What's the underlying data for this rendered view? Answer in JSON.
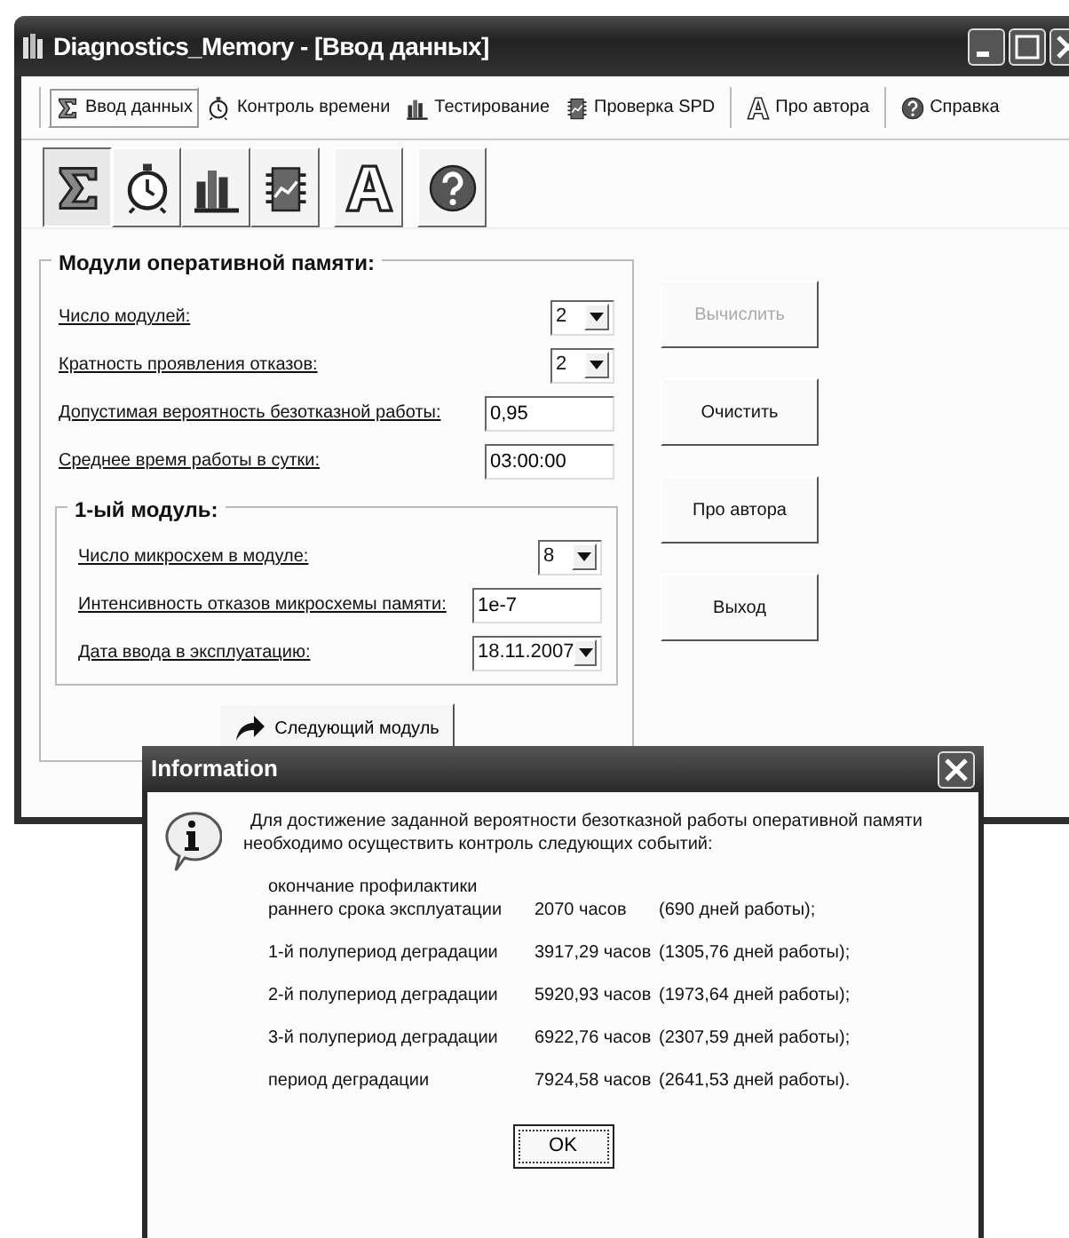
{
  "window": {
    "title": "Diagnostics_Memory - [Ввод данных]"
  },
  "menu_groups": [
    [
      {
        "label": "Ввод данных",
        "kind": "sigma",
        "selected": true
      },
      {
        "label": "Контроль времени",
        "kind": "clock",
        "selected": false
      },
      {
        "label": "Тестирование",
        "kind": "bars",
        "selected": false
      },
      {
        "label": "Проверка SPD",
        "kind": "chip",
        "selected": false
      }
    ],
    [
      {
        "label": "Про автора",
        "kind": "letter",
        "selected": false
      }
    ],
    [
      {
        "label": "Справка",
        "kind": "help",
        "selected": false
      }
    ]
  ],
  "toolbar_groups": [
    [
      {
        "kind": "sigma",
        "selected": true
      },
      {
        "kind": "clock",
        "selected": false
      },
      {
        "kind": "bars",
        "selected": false
      },
      {
        "kind": "chip",
        "selected": false
      }
    ],
    [
      {
        "kind": "letter",
        "selected": false
      }
    ],
    [
      {
        "kind": "help",
        "selected": false
      }
    ]
  ],
  "form": {
    "title": "Модули оперативной памяти:",
    "fields": [
      {
        "label": "Число модулей:",
        "kind": "combo",
        "value": "2"
      },
      {
        "label": "Кратность проявления отказов:",
        "kind": "combo",
        "value": "2"
      },
      {
        "label": "Допустимая вероятность безотказной работы:",
        "kind": "text",
        "value": "0,95"
      },
      {
        "label": "Среднее время работы в сутки:",
        "kind": "text",
        "value": "03:00:00"
      }
    ],
    "module": {
      "title": "1-ый модуль:",
      "fields": [
        {
          "label": "Число микросхем в модуле:",
          "kind": "combo",
          "value": "8"
        },
        {
          "label": "Интенсивность отказов микросхемы памяти:",
          "kind": "text",
          "value": "1e-7"
        },
        {
          "label": "Дата ввода в эксплуатацию:",
          "kind": "date",
          "value": "18.11.2007"
        }
      ]
    },
    "next_button": "Следующий модуль"
  },
  "buttons": [
    {
      "label": "Вычислить",
      "disabled": true
    },
    {
      "label": "Очистить",
      "disabled": false
    },
    {
      "label": "Про автора",
      "disabled": false
    },
    {
      "label": "Выход",
      "disabled": false
    }
  ],
  "dialog": {
    "title": "Information",
    "message": "Для достижение заданной вероятности безотказной работы оперативной памяти\nнеобходимо осуществить контроль следующих событий:",
    "rows": [
      {
        "event": "окончание профилактики\nраннего срока эксплуатации",
        "hours": "2070 часов",
        "days": "(690 дней работы);"
      },
      {
        "event": "1-й полупериод деградации",
        "hours": "3917,29 часов",
        "days": "(1305,76 дней работы);"
      },
      {
        "event": "2-й полупериод деградации",
        "hours": "5920,93 часов",
        "days": "(1973,64 дней работы);"
      },
      {
        "event": "3-й полупериод деградации",
        "hours": "6922,76 часов",
        "days": "(2307,59 дней работы);"
      },
      {
        "event": "период деградации",
        "hours": "7924,58 часов",
        "days": "(2641,53 дней работы)."
      }
    ],
    "ok": "OK"
  }
}
